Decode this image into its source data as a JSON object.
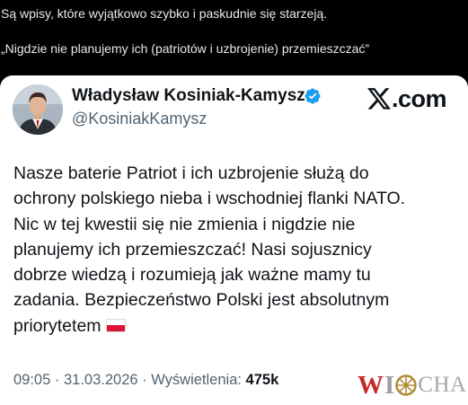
{
  "post": {
    "line1": "Są wpisy, które wyjątkowo szybko i paskudnie się starzeją.",
    "line2": "„Nigdzie nie planujemy ich (patriotów i uzbrojenie) przemieszczać”"
  },
  "tweet": {
    "author_name": "Władysław Kosiniak-Kamysz",
    "author_handle": "@KosiniakKamysz",
    "brand": ".com",
    "body_lines": [
      "Nasze baterie Patriot i ich uzbrojenie służą do",
      "ochrony polskiego nieba i wschodniej flanki NATO.",
      "Nic w tej kwestii się nie zmienia i nigdzie nie",
      "planujemy ich przemieszczać! Nasi sojusznicy",
      "dobrze wiedzą i rozumieją jak ważne mamy tu",
      "zadania. Bezpieczeństwo Polski jest absolutnym",
      "priorytetem"
    ],
    "flag_icon": "poland-flag-icon",
    "time": "09:05",
    "date": "31.03.2026",
    "views_label": "Wyświetlenia:",
    "views_count": "475k",
    "meta_separator": " · "
  },
  "watermark": {
    "w": "W",
    "i": "I",
    "cha": "CHA"
  },
  "colors": {
    "background": "#000000",
    "post_text": "#e7e9ea",
    "card_background": "#ffffff",
    "primary_text": "#0f1419",
    "secondary_text": "#536471",
    "verified_blue": "#1d9bf0",
    "watermark_red": "#c62828"
  }
}
